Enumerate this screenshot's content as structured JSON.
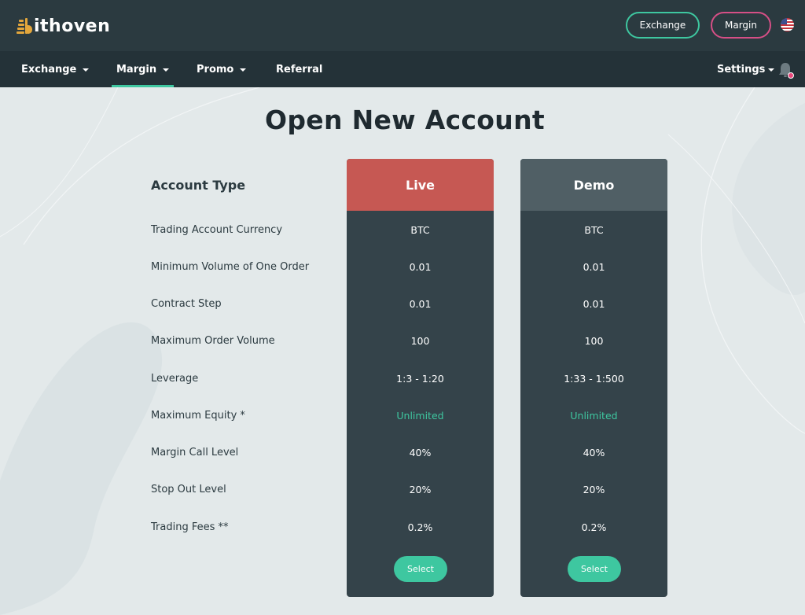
{
  "header": {
    "logo_text": "ithoven",
    "exchange_button": "Exchange",
    "margin_button": "Margin",
    "language_flag": "us-flag-icon"
  },
  "nav": {
    "items": [
      {
        "label": "Exchange",
        "dropdown": true
      },
      {
        "label": "Margin",
        "dropdown": true,
        "active": true
      },
      {
        "label": "Promo",
        "dropdown": true
      },
      {
        "label": "Referral",
        "dropdown": false
      }
    ],
    "settings_label": "Settings",
    "bell_icon": "bell-icon"
  },
  "page": {
    "title": "Open New Account"
  },
  "table": {
    "heading": "Account Type",
    "rows": [
      "Trading Account Currency",
      "Minimum Volume of One Order",
      "Contract Step",
      "Maximum Order Volume",
      "Leverage",
      "Maximum Equity *",
      "Margin Call Level",
      "Stop Out Level",
      "Trading Fees **"
    ],
    "accounts": [
      {
        "name": "Live",
        "values": [
          "BTC",
          "0.01",
          "0.01",
          "100",
          "1:3 - 1:20",
          "Unlimited",
          "40%",
          "20%",
          "0.2%"
        ],
        "select_label": "Select"
      },
      {
        "name": "Demo",
        "values": [
          "BTC",
          "0.01",
          "0.01",
          "100",
          "1:33 - 1:500",
          "Unlimited",
          "40%",
          "20%",
          "0.2%"
        ],
        "select_label": "Select"
      }
    ]
  },
  "colors": {
    "header_bg": "#2b3a40",
    "nav_bg": "#243238",
    "accent_green": "#3ec7a0",
    "accent_pink": "#d64f86",
    "live_header": "#c65853",
    "demo_header": "#505f65",
    "card_bg": "#34434a",
    "page_bg": "#e3e9ea"
  }
}
